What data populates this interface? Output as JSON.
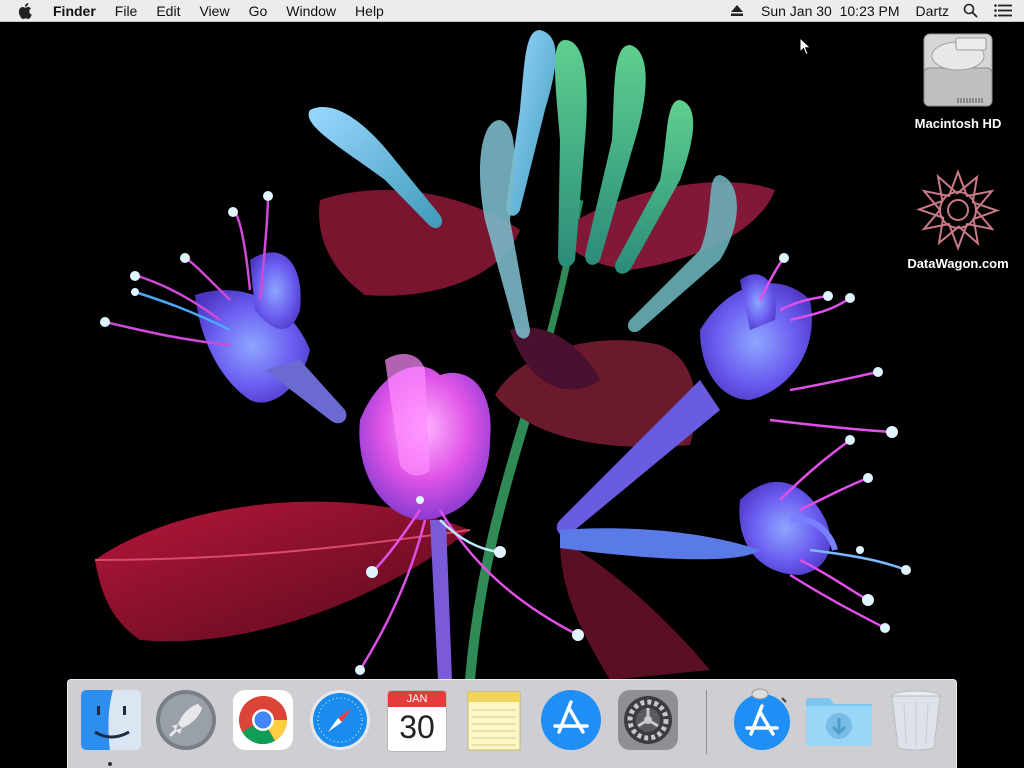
{
  "menubar": {
    "app_name": "Finder",
    "menus": [
      "File",
      "Edit",
      "View",
      "Go",
      "Window",
      "Help"
    ],
    "clock": "Sun Jan 30  10:23 PM",
    "user": "Dartz",
    "icons": [
      "apple-icon",
      "eject-icon",
      "spotlight-icon",
      "notification-center-icon"
    ]
  },
  "desktop": {
    "icons": [
      {
        "label": "Macintosh HD",
        "icon": "hard-drive-icon"
      },
      {
        "label": "DataWagon.com",
        "icon": "datawagon-logo-icon"
      }
    ]
  },
  "dock": {
    "items": [
      {
        "name": "Finder",
        "icon": "finder-icon",
        "running": true
      },
      {
        "name": "Launchpad",
        "icon": "launchpad-icon",
        "running": false
      },
      {
        "name": "Google Chrome",
        "icon": "chrome-icon",
        "running": false
      },
      {
        "name": "Safari",
        "icon": "safari-icon",
        "running": false
      },
      {
        "name": "Calendar",
        "icon": "calendar-icon",
        "running": false
      },
      {
        "name": "Notes",
        "icon": "notes-icon",
        "running": false
      },
      {
        "name": "App Store",
        "icon": "app-store-icon",
        "running": false
      },
      {
        "name": "System Preferences",
        "icon": "system-preferences-icon",
        "running": false
      },
      {
        "name": "App Store Installer",
        "icon": "app-store-installer-icon",
        "running": false
      },
      {
        "name": "Downloads",
        "icon": "downloads-folder-icon",
        "running": false
      },
      {
        "name": "Trash",
        "icon": "trash-icon",
        "running": false
      }
    ],
    "calendar_month": "JAN",
    "calendar_day": "30"
  },
  "colors": {
    "menubar_bg": "#ececec",
    "wallpaper_bg": "#000000",
    "dock_bg": "#ebebf0"
  }
}
